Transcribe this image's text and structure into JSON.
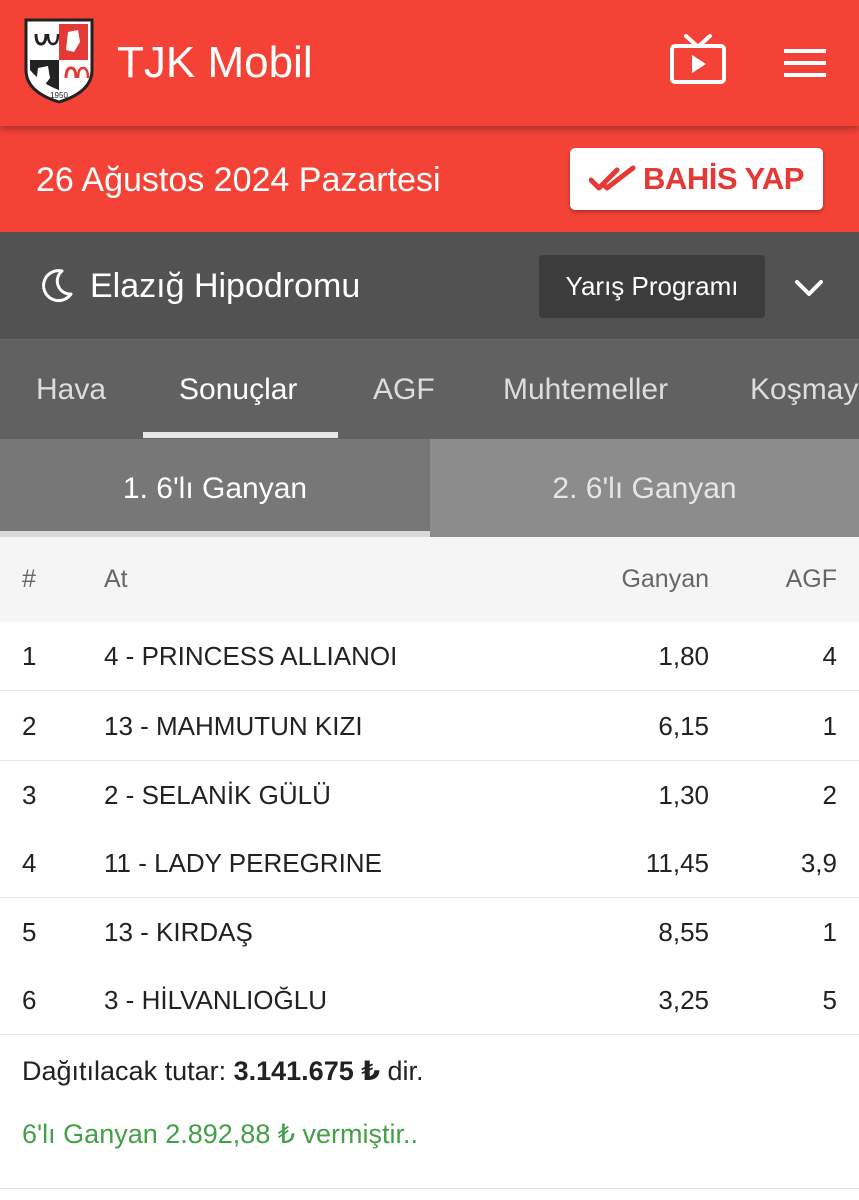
{
  "header": {
    "title": "TJK Mobil",
    "logo_year": "1950",
    "brand_color": "#f44336",
    "tv_icon": "tv-icon",
    "menu_icon": "hamburger-menu-icon"
  },
  "date_bar": {
    "date": "26 Ağustos 2024 Pazartesi",
    "bet_label": "BAHİS YAP",
    "bet_icon": "double-check-icon"
  },
  "hippodrome": {
    "icon": "moon-icon",
    "name": "Elazığ Hipodromu",
    "program_label": "Yarış Programı",
    "dropdown_icon": "chevron-down-icon"
  },
  "tabs": [
    {
      "label": "Hava",
      "active": false
    },
    {
      "label": "Sonuçlar",
      "active": true
    },
    {
      "label": "AGF",
      "active": false
    },
    {
      "label": "Muhtemeller",
      "active": false
    },
    {
      "label": "Koşmay",
      "active": false
    }
  ],
  "subtabs": [
    {
      "label": "1. 6'lı Ganyan",
      "active": true
    },
    {
      "label": "2. 6'lı Ganyan",
      "active": false
    }
  ],
  "table": {
    "headers": {
      "no": "#",
      "at": "At",
      "ganyan": "Ganyan",
      "agf": "AGF"
    },
    "rows": [
      {
        "no": "1",
        "at": "4 - PRINCESS ALLIANOI",
        "ganyan": "1,80",
        "agf": "4"
      },
      {
        "no": "2",
        "at": "13 - MAHMUTUN KIZI",
        "ganyan": "6,15",
        "agf": "1"
      },
      {
        "no": "3",
        "at": "2 - SELANİK GÜLÜ",
        "ganyan": "1,30",
        "agf": "2"
      },
      {
        "no": "4",
        "at": "11 - LADY PEREGRINE",
        "ganyan": "11,45",
        "agf": "3,9"
      },
      {
        "no": "5",
        "at": "13 - KIRDAŞ",
        "ganyan": "8,55",
        "agf": "1"
      },
      {
        "no": "6",
        "at": "3 - HİLVANLIOĞLU",
        "ganyan": "3,25",
        "agf": "5"
      }
    ]
  },
  "payout": {
    "prefix": "Dağıtılacak tutar: ",
    "amount": "3.141.675 ₺",
    "suffix": " dir."
  },
  "result": {
    "text": "6'lı Ganyan 2.892,88 ₺ vermiştir..",
    "color": "#43a047"
  }
}
